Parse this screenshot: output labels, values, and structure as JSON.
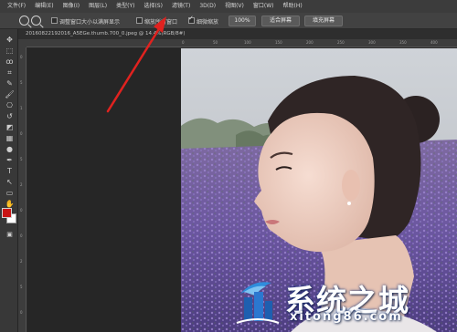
{
  "menubar": {
    "items": [
      "文件(F)",
      "编辑(E)",
      "图像(I)",
      "图层(L)",
      "类型(Y)",
      "选择(S)",
      "滤镜(T)",
      "3D(D)",
      "视图(V)",
      "窗口(W)",
      "帮助(H)"
    ]
  },
  "options": {
    "fit_windows_label": "调整窗口大小以满屏显示",
    "zoom_all_label": "缩放所有窗口",
    "scrubby_zoom_label": "细微缩放",
    "scrubby_zoom_checked": true,
    "btn_100": "100%",
    "btn_fit_screen": "适合屏幕",
    "btn_fill_screen": "填充屏幕"
  },
  "document": {
    "tab_title": "20160822192016_A5EGe.thumb.700_0.jpeg @ 14.4%(RGB/8#)"
  },
  "ruler": {
    "h_labels": [
      "0",
      "50",
      "100",
      "150",
      "200",
      "250",
      "300",
      "350",
      "400"
    ],
    "v_labels": [
      "0",
      "5",
      "1",
      "0",
      "5",
      "2",
      "0",
      "0",
      "2",
      "5",
      "0"
    ]
  },
  "tools": {
    "names": [
      "move-tool-icon",
      "marquee-tool-icon",
      "lasso-tool-icon",
      "crop-tool-icon",
      "eyedropper-tool-icon",
      "brush-tool-icon",
      "stamp-tool-icon",
      "history-brush-icon",
      "eraser-tool-icon",
      "gradient-tool-icon",
      "dodge-tool-icon",
      "pen-tool-icon",
      "type-tool-icon",
      "path-select-icon",
      "shape-tool-icon",
      "hand-tool-icon",
      "zoom-tool-icon"
    ],
    "glyphs": [
      "✥",
      "⬚",
      "ꝏ",
      "⌗",
      "✎",
      "🖌",
      "⎔",
      "↺",
      "◩",
      "▦",
      "●",
      "✒",
      "T",
      "↖",
      "▭",
      "✋",
      "🔍"
    ],
    "foreground_color": "#c81414",
    "background_color": "#ffffff"
  },
  "watermark": {
    "title": "系统之城",
    "url": "xitong86.com"
  },
  "colors": {
    "arrow": "#e0221f",
    "ui_bg": "#282828",
    "menubar": "#3c3c3c"
  }
}
